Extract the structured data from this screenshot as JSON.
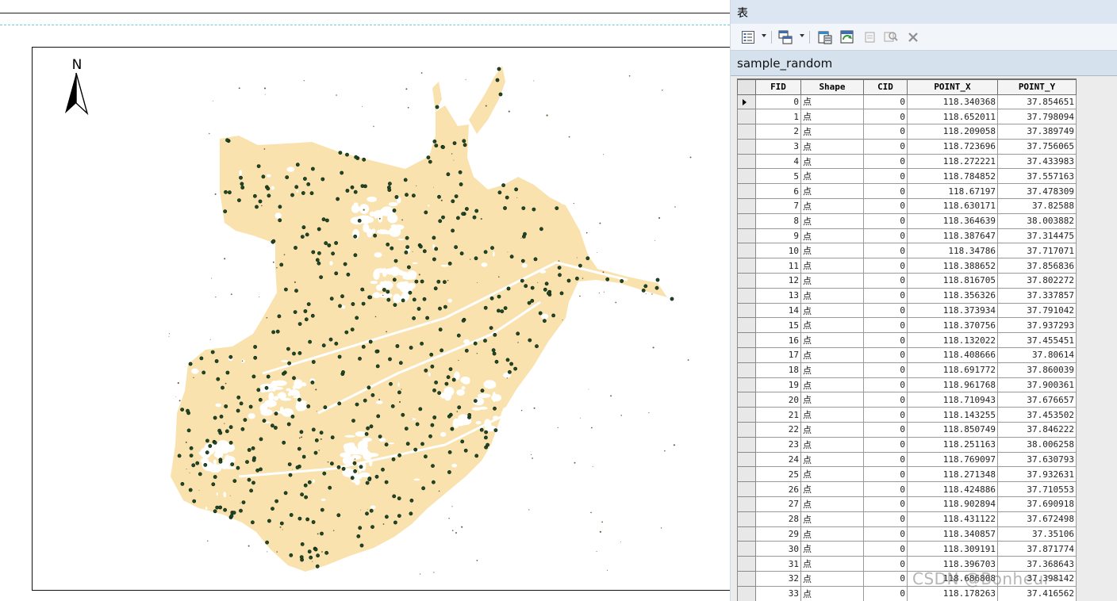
{
  "map": {
    "north_letter": "N",
    "region_fill": "#f9e2ad",
    "point_color": "#1f4a26"
  },
  "table_window": {
    "title": "表",
    "table_name": "sample_random",
    "toolbar_icons": [
      "table-options-icon",
      "related-tables-icon",
      "select-by-attributes-icon",
      "switch-selection-icon",
      "clear-selection-icon",
      "zoom-to-selected-icon",
      "delete-selected-icon"
    ],
    "columns": [
      "FID",
      "Shape",
      "CID",
      "POINT_X",
      "POINT_Y"
    ],
    "rows": [
      [
        "0",
        "点",
        "0",
        "118.340368",
        "37.854651"
      ],
      [
        "1",
        "点",
        "0",
        "118.652011",
        "37.798094"
      ],
      [
        "2",
        "点",
        "0",
        "118.209058",
        "37.389749"
      ],
      [
        "3",
        "点",
        "0",
        "118.723696",
        "37.756065"
      ],
      [
        "4",
        "点",
        "0",
        "118.272221",
        "37.433983"
      ],
      [
        "5",
        "点",
        "0",
        "118.784852",
        "37.557163"
      ],
      [
        "6",
        "点",
        "0",
        "118.67197",
        "37.478309"
      ],
      [
        "7",
        "点",
        "0",
        "118.630171",
        "37.82588"
      ],
      [
        "8",
        "点",
        "0",
        "118.364639",
        "38.003882"
      ],
      [
        "9",
        "点",
        "0",
        "118.387647",
        "37.314475"
      ],
      [
        "10",
        "点",
        "0",
        "118.34786",
        "37.717071"
      ],
      [
        "11",
        "点",
        "0",
        "118.388652",
        "37.856836"
      ],
      [
        "12",
        "点",
        "0",
        "118.816705",
        "37.802272"
      ],
      [
        "13",
        "点",
        "0",
        "118.356326",
        "37.337857"
      ],
      [
        "14",
        "点",
        "0",
        "118.373934",
        "37.791042"
      ],
      [
        "15",
        "点",
        "0",
        "118.370756",
        "37.937293"
      ],
      [
        "16",
        "点",
        "0",
        "118.132022",
        "37.455451"
      ],
      [
        "17",
        "点",
        "0",
        "118.408666",
        "37.80614"
      ],
      [
        "18",
        "点",
        "0",
        "118.691772",
        "37.860039"
      ],
      [
        "19",
        "点",
        "0",
        "118.961768",
        "37.900361"
      ],
      [
        "20",
        "点",
        "0",
        "118.710943",
        "37.676657"
      ],
      [
        "21",
        "点",
        "0",
        "118.143255",
        "37.453502"
      ],
      [
        "22",
        "点",
        "0",
        "118.850749",
        "37.846222"
      ],
      [
        "23",
        "点",
        "0",
        "118.251163",
        "38.006258"
      ],
      [
        "24",
        "点",
        "0",
        "118.769097",
        "37.630793"
      ],
      [
        "25",
        "点",
        "0",
        "118.271348",
        "37.932631"
      ],
      [
        "26",
        "点",
        "0",
        "118.424886",
        "37.710553"
      ],
      [
        "27",
        "点",
        "0",
        "118.902894",
        "37.690918"
      ],
      [
        "28",
        "点",
        "0",
        "118.431122",
        "37.672498"
      ],
      [
        "29",
        "点",
        "0",
        "118.340857",
        "37.35106"
      ],
      [
        "30",
        "点",
        "0",
        "118.309191",
        "37.871774"
      ],
      [
        "31",
        "点",
        "0",
        "118.396703",
        "37.368643"
      ],
      [
        "32",
        "点",
        "0",
        "118.686808",
        "37.398142"
      ],
      [
        "33",
        "点",
        "0",
        "118.178263",
        "37.416562"
      ]
    ],
    "selected_row": 0
  },
  "watermark": "CSDN @Bonheur~"
}
